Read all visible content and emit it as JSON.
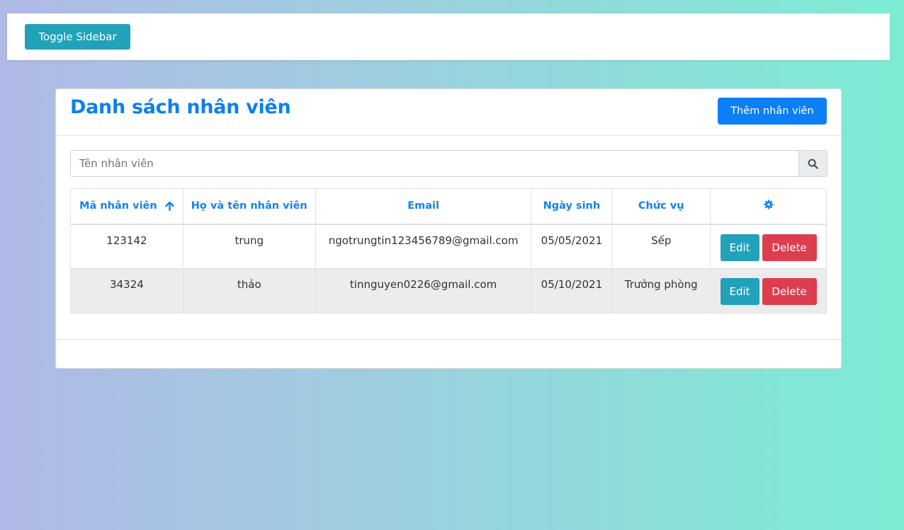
{
  "topbar": {
    "toggle_label": "Toggle Sidebar"
  },
  "card": {
    "title": "Danh sách nhân viên",
    "add_label": "Thêm nhân viên"
  },
  "search": {
    "placeholder": "Tên nhân viên",
    "value": ""
  },
  "table": {
    "columns": [
      "Mã nhân viên",
      "Họ và tên nhân viên",
      "Email",
      "Ngày sinh",
      "Chức vụ"
    ],
    "sort_column": "Mã nhân viên",
    "sort_direction": "ascending",
    "settings_icon": "gear-icon",
    "rows": [
      {
        "id": "123142",
        "name": "trung",
        "email": "ngotrungtin123456789@gmail.com",
        "dob": "05/05/2021",
        "role": "Sếp"
      },
      {
        "id": "34324",
        "name": "thảo",
        "email": "tinnguyen0226@gmail.com",
        "dob": "05/10/2021",
        "role": "Trưởng phòng"
      }
    ],
    "edit_label": "Edit",
    "delete_label": "Delete"
  },
  "colors": {
    "primary": "#0d7ff6",
    "info": "#21a2b8",
    "danger": "#dc3e4f",
    "header_text": "#1482ee"
  }
}
